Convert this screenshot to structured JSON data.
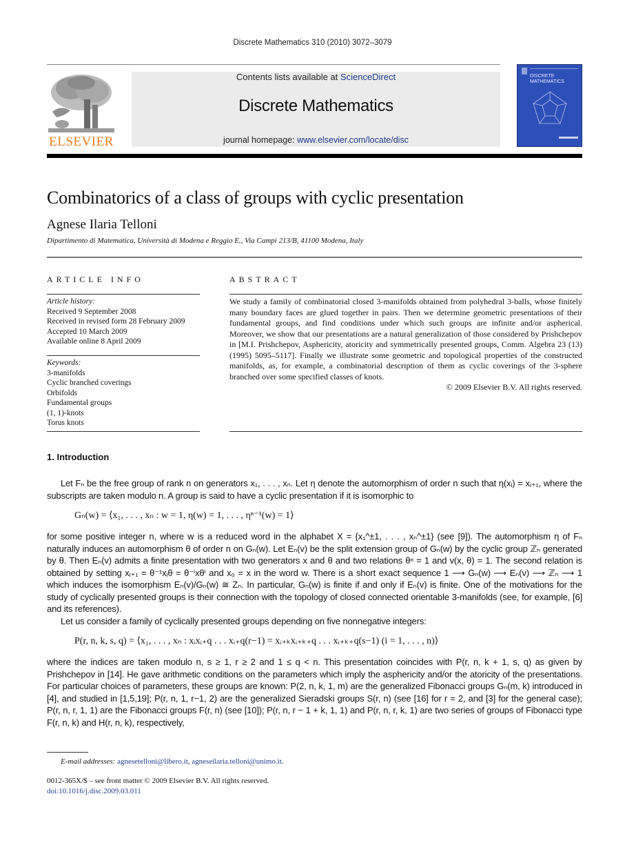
{
  "header": {
    "journal_ref": "Discrete Mathematics 310 (2010) 3072–3079",
    "contents_prefix": "Contents lists available at ",
    "contents_link": "ScienceDirect",
    "journal_title": "Discrete Mathematics",
    "homepage_prefix": "journal homepage: ",
    "homepage_link": "www.elsevier.com/locate/disc",
    "publisher_logo_text": "ELSEVIER",
    "cover_title_line1": "DISCRETE",
    "cover_title_line2": "MATHEMATICS"
  },
  "colors": {
    "link": "#1f3b8c",
    "elsevier_orange": "#f07c19",
    "cover_blue": "#2d4fb8",
    "band_gray": "#ebebeb"
  },
  "article": {
    "title": "Combinatorics of a class of groups with cyclic presentation",
    "author": "Agnese Ilaria Telloni",
    "affiliation": "Dipartimento di Matematica, Università di Modena e Reggio E., Via Campi 213/B, 41100 Modena, Italy"
  },
  "article_info": {
    "heading": "ARTICLE INFO",
    "history_label": "Article history:",
    "history": [
      "Received 9 September 2008",
      "Received in revised form 28 February 2009",
      "Accepted 10 March 2009",
      "Available online 8 April 2009"
    ],
    "keywords_label": "Keywords:",
    "keywords": [
      "3-manifolds",
      "Cyclic branched coverings",
      "Orbifolds",
      "Fundamental groups",
      "(1, 1)-knots",
      "Torus knots"
    ]
  },
  "abstract": {
    "heading": "ABSTRACT",
    "text": "We study a family of combinatorial closed 3-manifolds obtained from polyhedral 3-balls, whose finitely many boundary faces are glued together in pairs. Then we determine geometric presentations of their fundamental groups, and find conditions under which such groups are infinite and/or aspherical. Moreover, we show that our presentations are a natural generalization of those considered by Prishchepov in [M.I. Prishchepov, Asphericity, atoricity and symmetrically presented groups, Comm. Algebra 23 (13) (1995) 5095–5117]. Finally we illustrate some geometric and topological properties of the constructed manifolds, as, for example, a combinatorial description of them as cyclic coverings of the 3-sphere branched over some specified classes of knots.",
    "copyright": "© 2009 Elsevier B.V. All rights reserved."
  },
  "introduction": {
    "heading": "1.  Introduction",
    "p1": "Let Fₙ be the free group of rank n on generators x₁, . . . , xₙ. Let η denote the automorphism of order n such that η(xᵢ) = xᵢ₊₁, where the subscripts are taken modulo n. A group is said to have a cyclic presentation if it is isomorphic to",
    "p1_cyclic_term": "cyclic presentation",
    "eq1": "Gₙ(w) = ⟨x₁, . . . , xₙ : w = 1, η(w) = 1, . . . , ηⁿ⁻¹(w) = 1⟩",
    "p2": "for some positive integer n, where w is a reduced word in the alphabet X = {x₁^±1, . . . , xₙ^±1} (see [9]). The automorphism η of Fₙ naturally induces an automorphism θ of order n on Gₙ(w). Let Eₙ(v) be the split extension group of Gₙ(w) by the cyclic group ℤₙ generated by θ. Then Eₙ(v) admits a finite presentation with two generators x and θ and two relations θⁿ = 1 and v(x, θ) = 1. The second relation is obtained by setting xᵢ₊₁ = θ⁻¹xᵢθ = θ⁻ⁱxθⁱ and x₀ = x in the word w. There is a short exact sequence 1 ⟶ Gₙ(w) ⟶ Eₙ(v) ⟶ ℤₙ ⟶ 1 which induces the isomorphism Eₙ(v)/Gₙ(w) ≅ Zₙ. In particular, Gₙ(w) is finite if and only if Eₙ(v) is finite. One of the motivations for the study of cyclically presented groups is their connection with the topology of closed connected orientable 3-manifolds (see, for example, [6] and its references).",
    "p3": "Let us consider a family of cyclically presented groups depending on five nonnegative integers:",
    "eq2": "P(r, n, k, s, q) = ⟨x₁, . . . , xₙ : xᵢxᵢ₊q . . . xᵢ₊q(r−1) = xᵢ₊ₖxᵢ₊ₖ₊q . . . xᵢ₊ₖ₊q(s−1)    (i = 1, . . . , n)⟩",
    "p4": "where the indices are taken modulo n, s ≥ 1, r ≥ 2 and 1 ≤ q < n. This presentation coincides with P(r, n, k + 1, s, q) as given by Prishchepov in [14]. He gave arithmetic conditions on the parameters which imply the asphericity and/or the atoricity of the presentations. For particular choices of parameters, these groups are known: P(2, n, k, 1, m) are the generalized Fibonacci groups Gₙ(m, k) introduced in [4], and studied in [1,5,19]; P(r, n, 1, r−1, 2) are the generalized Sieradski groups S(r, n) (see [16] for r = 2, and [3] for the general case); P(r, n, r, 1, 1) are the Fibonacci groups F(r, n) (see [10]); P(r, n, r − 1 + k, 1, 1) and P(r, n, r, k, 1) are two series of groups of Fibonacci type F(r, n, k) and H(r, n, k), respectively,"
  },
  "footer": {
    "email_label": "E-mail addresses:",
    "email1": "agnesetelloni@libero.it",
    "email_sep": ", ",
    "email2": "agneseilaria.telloni@unimo.it",
    "email_end": ".",
    "issn": "0012-365X/$ – see front matter © 2009 Elsevier B.V. All rights reserved.",
    "doi": "doi:10.1016/j.disc.2009.03.011"
  }
}
